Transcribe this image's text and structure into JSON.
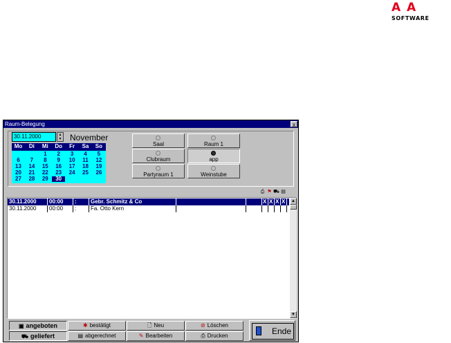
{
  "logo": {
    "letter_left": "A",
    "letter_right": "A",
    "subtitle": "SOFTWARE",
    "color": "#e0001a"
  },
  "window": {
    "title": "Raum-Belegung",
    "close": "x"
  },
  "datepicker": {
    "date": "30.11.2000",
    "month": "November",
    "weekdays": [
      "Mo",
      "Di",
      "Mi",
      "Do",
      "Fr",
      "Sa",
      "So"
    ],
    "weeks": [
      [
        "",
        "",
        "1",
        "2",
        "3",
        "4",
        "5"
      ],
      [
        "6",
        "7",
        "8",
        "9",
        "10",
        "11",
        "12"
      ],
      [
        "13",
        "14",
        "15",
        "16",
        "17",
        "18",
        "19"
      ],
      [
        "20",
        "21",
        "22",
        "23",
        "24",
        "25",
        "26"
      ],
      [
        "27",
        "28",
        "29",
        "30",
        "",
        "",
        ""
      ]
    ],
    "selected_day": "30",
    "background": "#00ffff"
  },
  "rooms": [
    {
      "name": "Saal",
      "active": false
    },
    {
      "name": "Raum 1",
      "active": false
    },
    {
      "name": "Clubraum",
      "active": false
    },
    {
      "name": "app",
      "active": true
    },
    {
      "name": "Partyraum 1",
      "active": false
    },
    {
      "name": "Weinstube",
      "active": false
    }
  ],
  "list": {
    "rows": [
      {
        "date": "30.11.2000",
        "start": "00:00",
        "end": ":",
        "customer": "Gebr. Schmitz & Co",
        "flags": [
          "X",
          "X",
          "X",
          "X"
        ],
        "selected": true
      },
      {
        "date": "30.11.2000",
        "start": "00:00",
        "end": ":",
        "customer": "Fa. Otto Kern",
        "flags": [
          "",
          "",
          "",
          ""
        ],
        "selected": false
      }
    ]
  },
  "buttons": {
    "angeboten": "angeboten",
    "bestaetigt": "bestätigt",
    "neu": "Neu",
    "loeschen": "Löschen",
    "geliefert": "geliefert",
    "abgerechnet": "abgerechnet",
    "bearbeiten": "Bearbeiten",
    "drucken": "Drucken",
    "ende": "Ende"
  },
  "icons": {
    "status_columns": [
      "printer-icon",
      "flag-icon",
      "car-icon",
      "document-icon"
    ],
    "scroll_up": "▲",
    "scroll_down": "▼"
  }
}
